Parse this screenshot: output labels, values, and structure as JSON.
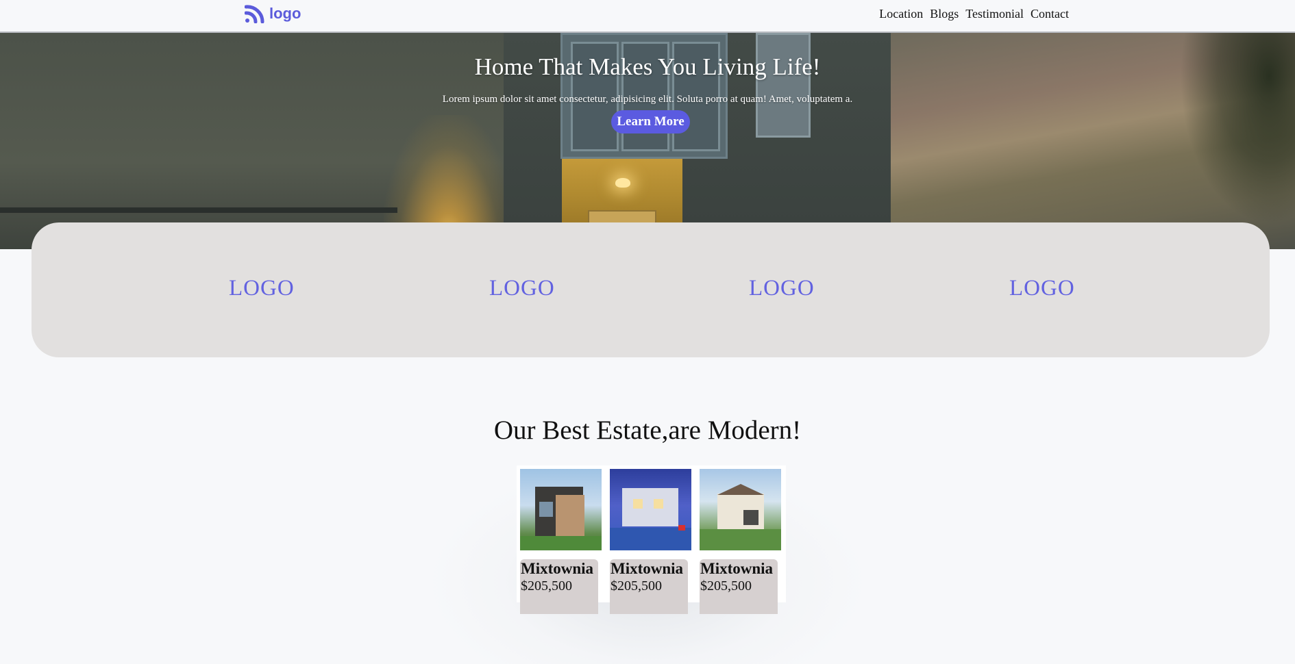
{
  "header": {
    "logo_text": "logo",
    "nav": [
      "Location",
      "Blogs",
      "Testimonial",
      "Contact"
    ]
  },
  "hero": {
    "title": "Home That Makes You Living Life!",
    "subtitle": "Lorem ipsum dolor sit amet consectetur, adipisicing elit. Soluta porro at quam! Amet, voluptatem a.",
    "button_label": "Learn More"
  },
  "partners": {
    "logos": [
      "LOGO",
      "LOGO",
      "LOGO",
      "LOGO"
    ]
  },
  "estates": {
    "title": "Our Best Estate,are Modern!",
    "cards": [
      {
        "name": "Mixtownia",
        "price": "$205,500"
      },
      {
        "name": "Mixtownia",
        "price": "$205,500"
      },
      {
        "name": "Mixtownia",
        "price": "$205,500"
      }
    ]
  },
  "colors": {
    "accent": "#5b5be0",
    "partner_bg": "#e2e0df",
    "card_info_bg": "#d6d0d0",
    "page_bg": "#f7f8fa"
  }
}
